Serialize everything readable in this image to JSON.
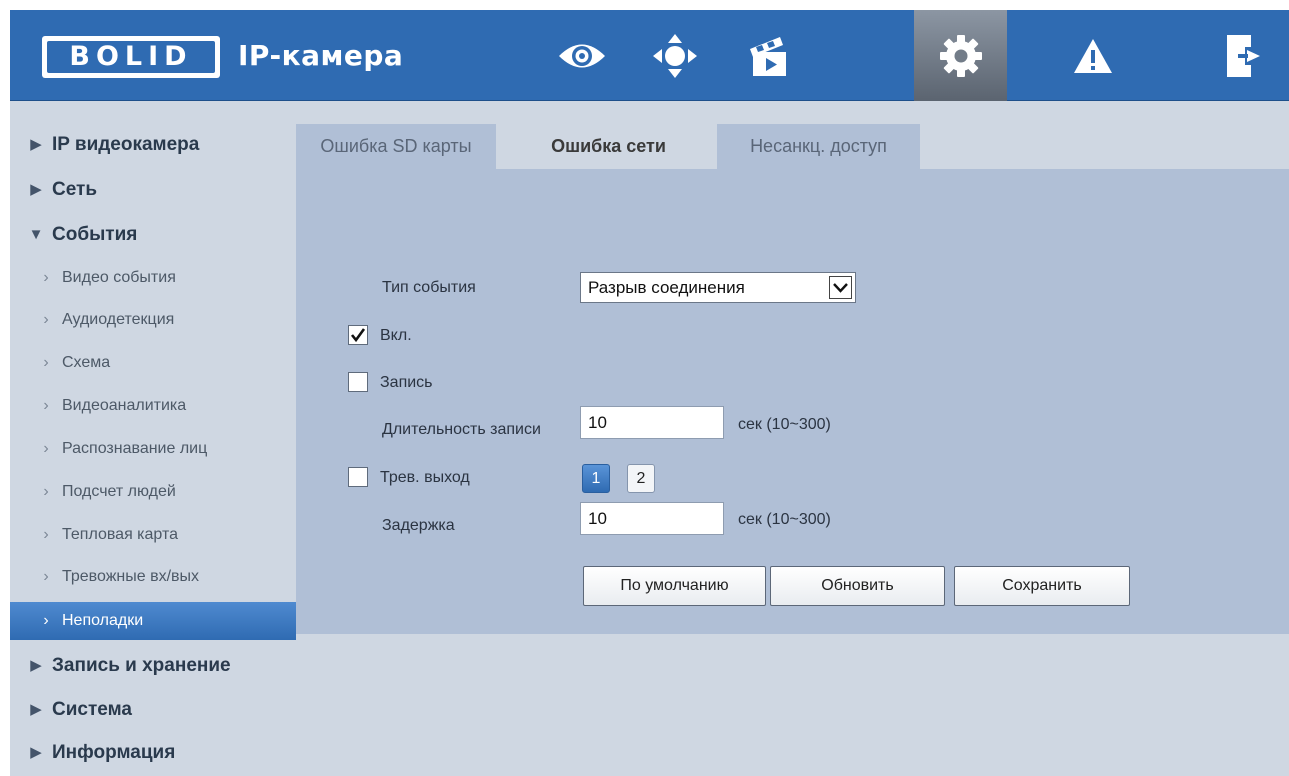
{
  "header": {
    "logo": "BOLID",
    "title": "IP-камера",
    "nav": [
      {
        "icon": "eye-icon"
      },
      {
        "icon": "ptz-control-icon"
      },
      {
        "icon": "clapperboard-icon"
      },
      {
        "icon": "gear-icon",
        "active": true
      },
      {
        "icon": "warning-icon"
      },
      {
        "icon": "logout-icon"
      }
    ]
  },
  "sidebar": {
    "items": [
      {
        "label": "IP видеокамера",
        "level": "top",
        "expanded": false
      },
      {
        "label": "Сеть",
        "level": "top",
        "expanded": false
      },
      {
        "label": "События",
        "level": "top",
        "expanded": true
      },
      {
        "label": "Видео события",
        "level": "sub"
      },
      {
        "label": "Аудиодетекция",
        "level": "sub"
      },
      {
        "label": "Схема",
        "level": "sub"
      },
      {
        "label": "Видеоаналитика",
        "level": "sub"
      },
      {
        "label": "Распознавание лиц",
        "level": "sub"
      },
      {
        "label": "Подсчет людей",
        "level": "sub"
      },
      {
        "label": "Тепловая карта",
        "level": "sub"
      },
      {
        "label": "Тревожные вх/вых",
        "level": "sub"
      },
      {
        "label": "Неполадки",
        "level": "sub",
        "selected": true
      },
      {
        "label": "Запись и хранение",
        "level": "top",
        "expanded": false
      },
      {
        "label": "Система",
        "level": "top",
        "expanded": false
      },
      {
        "label": "Информация",
        "level": "top",
        "expanded": false
      }
    ]
  },
  "tabs": [
    {
      "label": "Ошибка SD карты",
      "active": false
    },
    {
      "label": "Ошибка сети",
      "active": true
    },
    {
      "label": "Несанкц. доступ",
      "active": false
    }
  ],
  "form": {
    "event_type_label": "Тип события",
    "event_type_value": "Разрыв соединения",
    "enable_label": "Вкл.",
    "enable_checked": true,
    "record_label": "Запись",
    "record_checked": false,
    "record_duration_label": "Длительность записи",
    "record_duration_value": "10",
    "record_duration_unit": "сек (10~300)",
    "alarm_out_label": "Трев. выход",
    "alarm_out_checked": false,
    "alarm_channels": [
      "1",
      "2"
    ],
    "alarm_channel_selected": "1",
    "delay_label": "Задержка",
    "delay_value": "10",
    "delay_unit": "сек (10~300)",
    "buttons": {
      "default": "По умолчанию",
      "refresh": "Обновить",
      "save": "Сохранить"
    }
  },
  "colors": {
    "header_bg": "#2f6bb2",
    "panel_bg": "#b0bfd6",
    "sidebar_bg": "#cfd7e2",
    "selected_item_bg": "#2f6bb2"
  }
}
